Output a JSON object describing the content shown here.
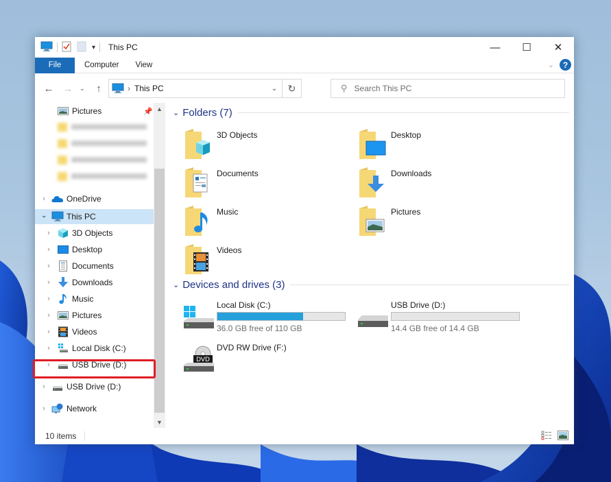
{
  "window": {
    "title": "This PC",
    "controls": {
      "minimize": "—",
      "maximize": "☐",
      "close": "✕"
    }
  },
  "quick_access_toolbar": {
    "icons": [
      "this-pc-icon",
      "properties-icon",
      "new-folder-icon",
      "customize-dropdown-icon"
    ]
  },
  "ribbon": {
    "tabs": [
      {
        "label": "File",
        "active": true
      },
      {
        "label": "Computer"
      },
      {
        "label": "View"
      }
    ],
    "help_label": "?"
  },
  "nav": {
    "back": "←",
    "forward": "→",
    "recent": "⌄",
    "up": "↑",
    "address": {
      "separator": "›",
      "path": "This PC"
    },
    "refresh": "↻",
    "search_placeholder": "Search This PC"
  },
  "sidebar": {
    "quick_access_pinned": {
      "label": "Pictures"
    },
    "blurred_items_count": 4,
    "items": [
      {
        "label": "OneDrive",
        "icon": "onedrive-icon",
        "level": 0
      },
      {
        "label": "This PC",
        "icon": "this-pc-icon",
        "level": 0,
        "expanded": true,
        "selected": true
      },
      {
        "label": "3D Objects",
        "icon": "3d-objects-icon",
        "level": 1
      },
      {
        "label": "Desktop",
        "icon": "desktop-icon",
        "level": 1
      },
      {
        "label": "Documents",
        "icon": "documents-icon",
        "level": 1
      },
      {
        "label": "Downloads",
        "icon": "downloads-icon",
        "level": 1
      },
      {
        "label": "Music",
        "icon": "music-icon",
        "level": 1
      },
      {
        "label": "Pictures",
        "icon": "pictures-icon",
        "level": 1
      },
      {
        "label": "Videos",
        "icon": "videos-icon",
        "level": 1
      },
      {
        "label": "Local Disk (C:)",
        "icon": "local-disk-icon",
        "level": 1
      },
      {
        "label": "USB Drive (D:)",
        "icon": "usb-drive-icon",
        "level": 1,
        "highlighted": true
      },
      {
        "label": "USB Drive (D:)",
        "icon": "usb-drive-icon",
        "level": 0
      },
      {
        "label": "Network",
        "icon": "network-icon",
        "level": 0
      }
    ]
  },
  "content": {
    "folders_group": {
      "label": "Folders (7)"
    },
    "folders": [
      {
        "name": "3D Objects",
        "icon": "3d-objects-icon"
      },
      {
        "name": "Desktop",
        "icon": "desktop-icon"
      },
      {
        "name": "Documents",
        "icon": "documents-icon"
      },
      {
        "name": "Downloads",
        "icon": "downloads-icon"
      },
      {
        "name": "Music",
        "icon": "music-icon"
      },
      {
        "name": "Pictures",
        "icon": "pictures-icon"
      },
      {
        "name": "Videos",
        "icon": "videos-icon"
      }
    ],
    "drives_group": {
      "label": "Devices and drives (3)"
    },
    "drives": [
      {
        "name": "Local Disk (C:)",
        "free_text": "36.0 GB free of 110 GB",
        "used_fraction": 0.673,
        "icon": "local-disk-icon"
      },
      {
        "name": "USB Drive (D:)",
        "free_text": "14.4 GB free of 14.4 GB",
        "used_fraction": 0.0,
        "icon": "usb-drive-icon"
      },
      {
        "name": "DVD RW Drive (F:)",
        "icon": "dvd-drive-icon"
      }
    ]
  },
  "status_bar": {
    "item_count": "10 items"
  },
  "colors": {
    "accent": "#1a6bb8",
    "selection": "#cce4f7",
    "progress_fill": "#26a0da",
    "highlight_box": "#e01c24",
    "group_header": "#1e3287"
  }
}
